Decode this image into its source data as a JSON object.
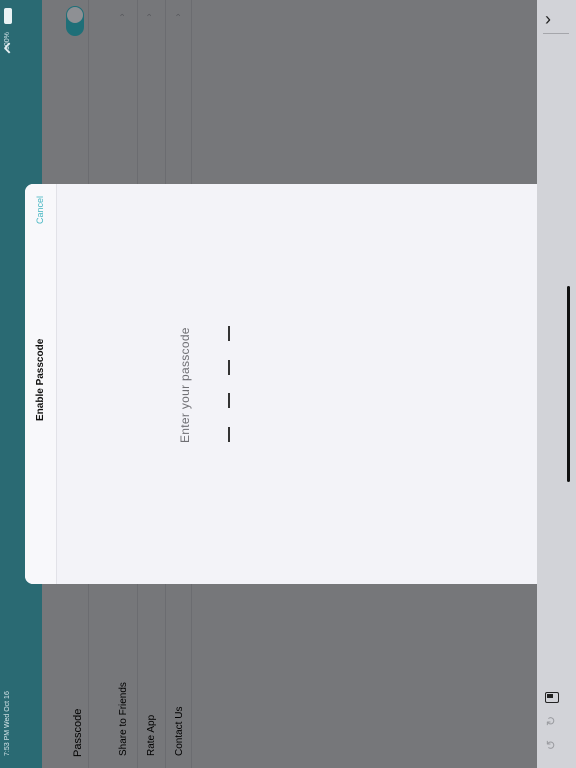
{
  "status_bar": {
    "time": "7:53 PM  Wed Oct 16",
    "battery": "100%"
  },
  "settings": {
    "items": [
      {
        "label": "Passcode"
      },
      {
        "label": "Share to Friends"
      },
      {
        "label": "Rate App"
      },
      {
        "label": "Contact Us"
      }
    ]
  },
  "modal": {
    "title": "Enable Passcode",
    "cancel_label": "Cancel",
    "prompt": "Enter your passcode"
  },
  "icons": {
    "chevron": "chevron-right-icon",
    "screenshot": "screenshot-icon",
    "redo": "redo-icon",
    "undo": "undo-icon"
  }
}
